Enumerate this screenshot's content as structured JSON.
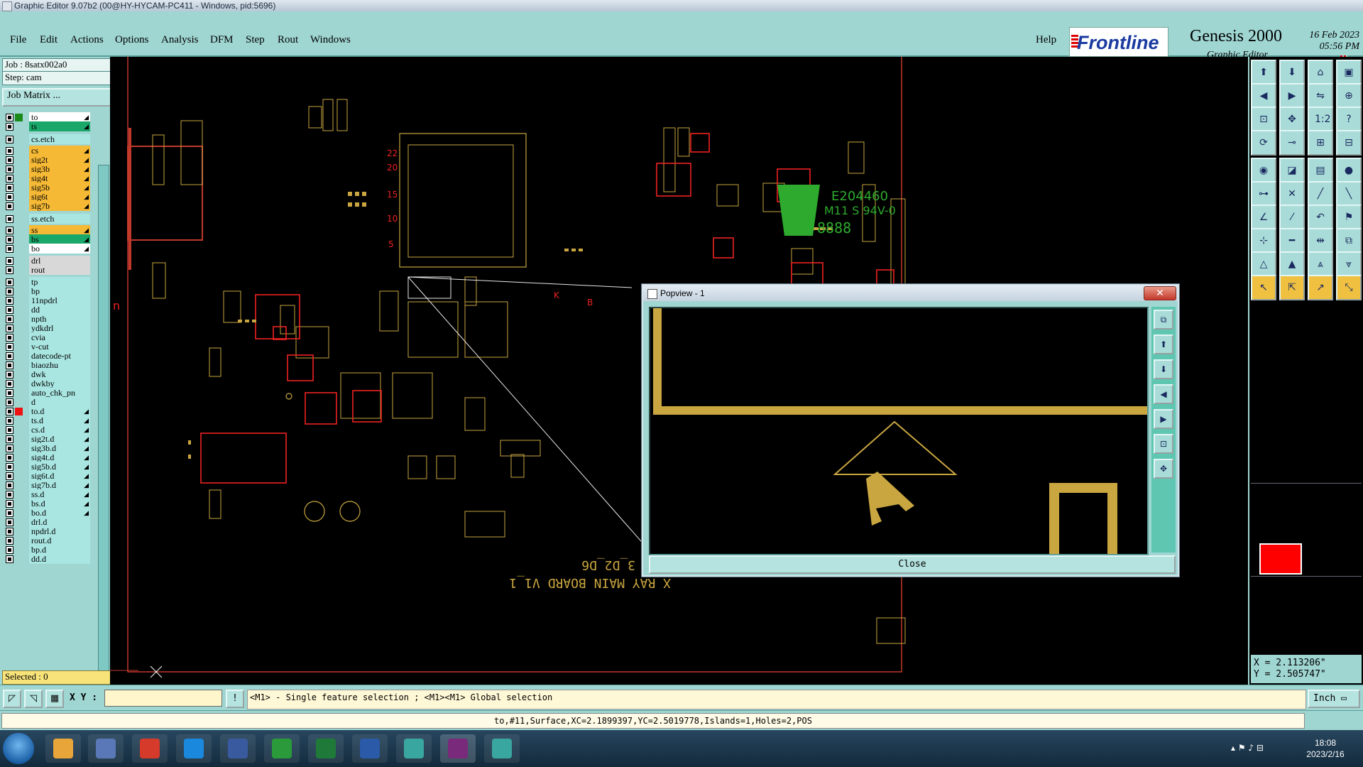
{
  "window": {
    "title": "Graphic Editor 9.07b2 (00@HY-HYCAM-PC411 - Windows, pid:5696)"
  },
  "menu": {
    "items": [
      "File",
      "Edit",
      "Actions",
      "Options",
      "Analysis",
      "DFM",
      "Step",
      "Rout",
      "Windows"
    ],
    "help": "Help"
  },
  "brand": {
    "logo": "Frontline",
    "product": "Genesis 2000",
    "subtitle": "Graphic Editor",
    "date": "16 Feb 2023",
    "time": "05:56 PM"
  },
  "left_panel": {
    "job": "Job : 8satx002a0",
    "step": "Step: cam",
    "job_matrix": "Job Matrix ...",
    "selected": "Selected : 0",
    "layers": [
      {
        "name": "to",
        "bg": "#ffffff",
        "mark": "#1a8a1a",
        "arrow": true
      },
      {
        "name": "ts",
        "bg": "#1aa76a",
        "mark": "",
        "arrow": true
      },
      {
        "name": "cs.etch",
        "bg": "#a9e6e2",
        "mark": "",
        "arrow": false
      },
      {
        "name": "cs",
        "bg": "#f5b935",
        "mark": "",
        "arrow": true
      },
      {
        "name": "sig2t",
        "bg": "#f5b935",
        "mark": "",
        "arrow": true
      },
      {
        "name": "sig3b",
        "bg": "#f5b935",
        "mark": "",
        "arrow": true
      },
      {
        "name": "sig4t",
        "bg": "#f5b935",
        "mark": "",
        "arrow": true
      },
      {
        "name": "sig5b",
        "bg": "#f5b935",
        "mark": "",
        "arrow": true
      },
      {
        "name": "sig6t",
        "bg": "#f5b935",
        "mark": "",
        "arrow": true
      },
      {
        "name": "sig7b",
        "bg": "#f5b935",
        "mark": "",
        "arrow": true
      },
      {
        "name": "ss.etch",
        "bg": "#a9e6e2",
        "mark": "",
        "arrow": false
      },
      {
        "name": "ss",
        "bg": "#f5b935",
        "mark": "",
        "arrow": true
      },
      {
        "name": "bs",
        "bg": "#1aa76a",
        "mark": "",
        "arrow": true
      },
      {
        "name": "bo",
        "bg": "#ffffff",
        "mark": "",
        "arrow": true
      },
      {
        "name": "drl",
        "bg": "#d8d8d8",
        "mark": "",
        "arrow": false
      },
      {
        "name": "rout",
        "bg": "#d8d8d8",
        "mark": "",
        "arrow": false
      },
      {
        "name": "tp",
        "bg": "#a9e6e2",
        "mark": "",
        "arrow": false
      },
      {
        "name": "bp",
        "bg": "#a9e6e2",
        "mark": "",
        "arrow": false
      },
      {
        "name": "11npdrl",
        "bg": "#a9e6e2",
        "mark": "",
        "arrow": false
      },
      {
        "name": "dd",
        "bg": "#a9e6e2",
        "mark": "",
        "arrow": false
      },
      {
        "name": "npth",
        "bg": "#a9e6e2",
        "mark": "",
        "arrow": false
      },
      {
        "name": "ydkdrl",
        "bg": "#a9e6e2",
        "mark": "",
        "arrow": false
      },
      {
        "name": "cvia",
        "bg": "#a9e6e2",
        "mark": "",
        "arrow": false
      },
      {
        "name": "v-cut",
        "bg": "#a9e6e2",
        "mark": "",
        "arrow": false
      },
      {
        "name": "datecode-pt",
        "bg": "#a9e6e2",
        "mark": "",
        "arrow": false
      },
      {
        "name": "biaozhu",
        "bg": "#a9e6e2",
        "mark": "",
        "arrow": false
      },
      {
        "name": "dwk",
        "bg": "#a9e6e2",
        "mark": "",
        "arrow": false
      },
      {
        "name": "dwkby",
        "bg": "#a9e6e2",
        "mark": "",
        "arrow": false
      },
      {
        "name": "auto_chk_pn",
        "bg": "#a9e6e2",
        "mark": "",
        "arrow": false
      },
      {
        "name": "d",
        "bg": "#a9e6e2",
        "mark": "",
        "arrow": false
      },
      {
        "name": "to.d",
        "bg": "#a9e6e2",
        "mark": "#ee1111",
        "arrow": true
      },
      {
        "name": "ts.d",
        "bg": "#a9e6e2",
        "mark": "",
        "arrow": true
      },
      {
        "name": "cs.d",
        "bg": "#a9e6e2",
        "mark": "",
        "arrow": true
      },
      {
        "name": "sig2t.d",
        "bg": "#a9e6e2",
        "mark": "",
        "arrow": true
      },
      {
        "name": "sig3b.d",
        "bg": "#a9e6e2",
        "mark": "",
        "arrow": true
      },
      {
        "name": "sig4t.d",
        "bg": "#a9e6e2",
        "mark": "",
        "arrow": true
      },
      {
        "name": "sig5b.d",
        "bg": "#a9e6e2",
        "mark": "",
        "arrow": true
      },
      {
        "name": "sig6t.d",
        "bg": "#a9e6e2",
        "mark": "",
        "arrow": true
      },
      {
        "name": "sig7b.d",
        "bg": "#a9e6e2",
        "mark": "",
        "arrow": true
      },
      {
        "name": "ss.d",
        "bg": "#a9e6e2",
        "mark": "",
        "arrow": true
      },
      {
        "name": "bs.d",
        "bg": "#a9e6e2",
        "mark": "",
        "arrow": true
      },
      {
        "name": "bo.d",
        "bg": "#a9e6e2",
        "mark": "",
        "arrow": true
      },
      {
        "name": "drl.d",
        "bg": "#a9e6e2",
        "mark": "",
        "arrow": false
      },
      {
        "name": "npdrl.d",
        "bg": "#a9e6e2",
        "mark": "",
        "arrow": false
      },
      {
        "name": "rout.d",
        "bg": "#a9e6e2",
        "mark": "",
        "arrow": false
      },
      {
        "name": "bp.d",
        "bg": "#a9e6e2",
        "mark": "",
        "arrow": false
      },
      {
        "name": "dd.d",
        "bg": "#a9e6e2",
        "mark": "",
        "arrow": false
      }
    ]
  },
  "canvas": {
    "board_text": "X RAY MAIN BOARD V1_1",
    "board_text2": "3_D2_D6",
    "ul_code": "E204460",
    "ul_rating": "M11 S 94V-0",
    "ul_digits": "8888",
    "side_numbers": [
      "22",
      "20",
      "15",
      "10",
      "5"
    ],
    "letters": [
      "K",
      "B"
    ]
  },
  "popview": {
    "title": "Popview - 1",
    "close_label": "Close"
  },
  "coords": {
    "x": "X = 2.113206\"",
    "y": "Y = 2.505747\""
  },
  "bottom": {
    "xy_label": "X Y :",
    "hint": "<M1> - Single feature selection ; <M1><M1> Global selection",
    "unit": "Inch"
  },
  "status": {
    "text": "to,#11,Surface,XC=2.1899397,YC=2.5019778,Islands=1,Holes=2,POS"
  },
  "taskbar": {
    "time": "18:08",
    "date": "2023/2/16"
  },
  "colors": {
    "panel": "#9fd6d2",
    "copper": "#c9a640",
    "silk": "#c0392b",
    "selected": "#ff0000"
  },
  "right_tools": {
    "icons": [
      "layer-up-icon",
      "layer-down-icon",
      "home-icon",
      "window-icon",
      "pan-left-icon",
      "pan-right-icon",
      "mirror-icon",
      "zoom-icon",
      "fit-icon",
      "center-icon",
      "scale-icon",
      "help-icon",
      "rotate-icon",
      "measure-icon",
      "net-icon",
      "net2-icon",
      "snap-icon",
      "box-icon",
      "ruler-icon",
      "dot-icon",
      "connect-icon",
      "cross-icon",
      "line-icon",
      "line2-icon",
      "edit-icon",
      "slash-icon",
      "arc-icon",
      "flag-icon",
      "add-pad-icon",
      "minus-icon",
      "move-icon",
      "copy-icon",
      "shape-a-icon",
      "shape-b-icon",
      "shape-c-icon",
      "shape-d-icon",
      "pointer-icon",
      "pointer-select-icon",
      "pointer-edit-icon",
      "pointer-multi-icon"
    ],
    "glyphs": [
      "⬆",
      "⬇",
      "⌂",
      "▣",
      "◀",
      "▶",
      "⇋",
      "⊕",
      "⊡",
      "✥",
      "1:2",
      "?",
      "⟳",
      "⊸",
      "⊞",
      "⊟",
      "◉",
      "◪",
      "▤",
      "●",
      "⊶",
      "✕",
      "╱",
      "╲",
      "∠",
      "⁄",
      "↶",
      "⚑",
      "⊹",
      "━",
      "⇹",
      "⧉",
      "△",
      "▲",
      "⩓",
      "⩔",
      "↖",
      "⇱",
      "↗",
      "⤡"
    ]
  }
}
